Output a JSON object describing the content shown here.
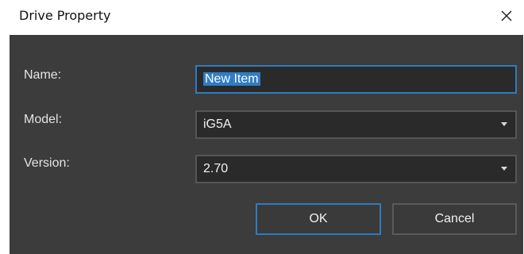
{
  "window": {
    "title": "Drive Property",
    "close_icon": "close-icon"
  },
  "form": {
    "name_label": "Name:",
    "name_value": "New Item",
    "model_label": "Model:",
    "model_value": "iG5A",
    "version_label": "Version:",
    "version_value": "2.70"
  },
  "buttons": {
    "ok_label": "OK",
    "cancel_label": "Cancel"
  },
  "colors": {
    "dialog_bg": "#3c3c3c",
    "field_bg": "#2a2a2a",
    "focus_border": "#2f7bbf",
    "selection": "#2f7dc5"
  }
}
